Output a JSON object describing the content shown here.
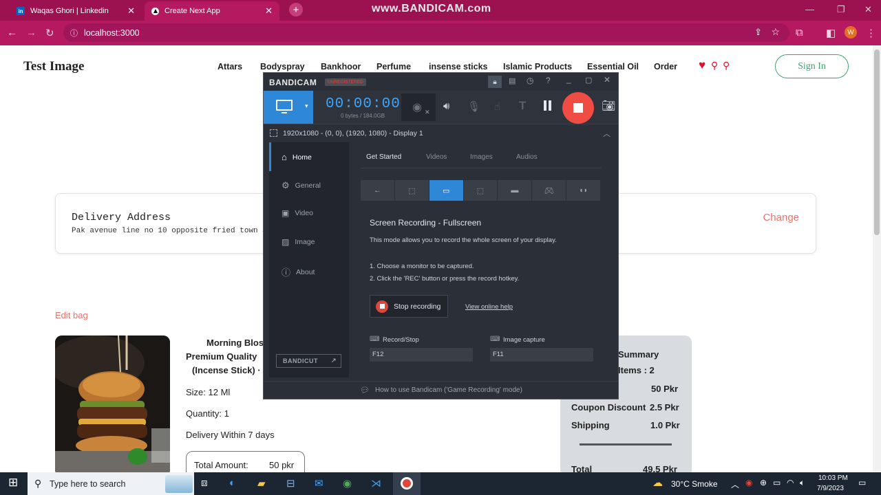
{
  "browser": {
    "tabs": [
      {
        "label": "Waqas Ghori | Linkedin",
        "icon": "linkedin-icon"
      },
      {
        "label": "Create Next App",
        "icon": "nextjs-icon"
      }
    ],
    "url": "localhost:3000",
    "watermark": "www.BANDICAM.com",
    "profile_initial": "W"
  },
  "site": {
    "logo": "Test Image",
    "nav": [
      "Attars",
      "Bodyspray",
      "Bankhoor",
      "Perfume",
      "insense sticks",
      "Islamic Products",
      "Essential Oil",
      "Order"
    ],
    "sign_in": "Sign In",
    "address": {
      "title": "Delivery Address",
      "line": "Pak avenue line no 10 opposite fried town Sa",
      "change": "Change"
    },
    "edit_bag": "Edit bag",
    "product": {
      "name_lines": [
        "Morning Blos",
        "Premium Quality",
        "(Incense Stick) ·"
      ],
      "size": "Size: 12 Ml",
      "quantity": "Quantity: 1",
      "delivery": "Delivery Within 7 days",
      "total_label": "Total Amount:",
      "total_value": "50 pkr"
    },
    "summary": {
      "title": "Summary",
      "items": "Items : 2",
      "subtotal": "50 Pkr",
      "coupon_label": "Coupon Discount",
      "coupon_value": "2.5 Pkr",
      "shipping_label": "Shipping",
      "shipping_value": "1.0 Pkr",
      "total_label": "Total",
      "total_value": "49.5 Pkr"
    }
  },
  "bandicam": {
    "logo": "BANDICAM",
    "badge": "UNREGISTERED",
    "timer": "00:00:00",
    "bytes": "0 bytes / 184.0GB",
    "display_info": "1920x1080 - (0, 0), (1920, 1080) - Display 1",
    "sidebar": [
      "Home",
      "General",
      "Video",
      "Image",
      "About"
    ],
    "bandicut": "BANDICUT",
    "tabs": [
      "Get Started",
      "Videos",
      "Images",
      "Audios"
    ],
    "mode_title": "Screen Recording - Fullscreen",
    "mode_desc": "This mode allows you to record the whole screen of your display.",
    "step1": "1. Choose a monitor to be captured.",
    "step2": "2. Click the 'REC' button or press the record hotkey.",
    "stop_label": "Stop recording",
    "help_link": "View online help",
    "hotkey_rec_label": "Record/Stop",
    "hotkey_rec_value": "F12",
    "hotkey_img_label": "Image capture",
    "hotkey_img_value": "F11",
    "bottom_tip": "How to use Bandicam ('Game Recording' mode)"
  },
  "taskbar": {
    "search_placeholder": "Type here to search",
    "weather": "30°C  Smoke",
    "time": "10:03 PM",
    "date": "7/9/2023"
  },
  "colors": {
    "browser": "#b5195f",
    "accent_red": "#e8736c",
    "bandicam_blue": "#2f87d8",
    "signin_green": "#3aa36b"
  }
}
